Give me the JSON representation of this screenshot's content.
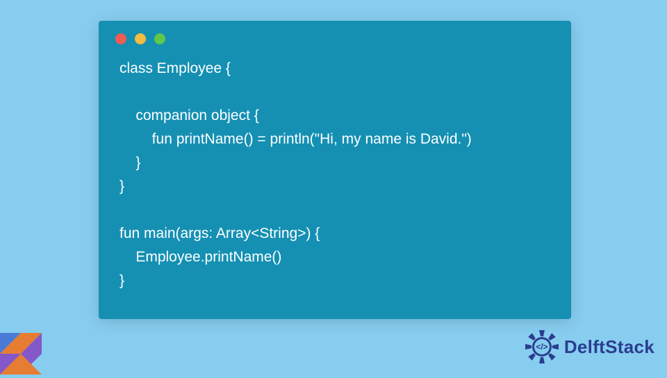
{
  "code": {
    "lines": [
      "class Employee {",
      "",
      "    companion object {",
      "        fun printName() = println(\"Hi, my name is David.\")",
      "    }",
      "}",
      "",
      "fun main(args: Array<String>) {",
      "    Employee.printName()",
      "}"
    ]
  },
  "brand": {
    "name": "DelftStack"
  },
  "colors": {
    "page_bg": "#87cdf0",
    "panel_bg": "#1590b3",
    "code_text": "#ffffff",
    "brand_text": "#2a3d8f",
    "dot_red": "#ee5c54",
    "dot_yellow": "#f1bc41",
    "dot_green": "#5dc849"
  }
}
